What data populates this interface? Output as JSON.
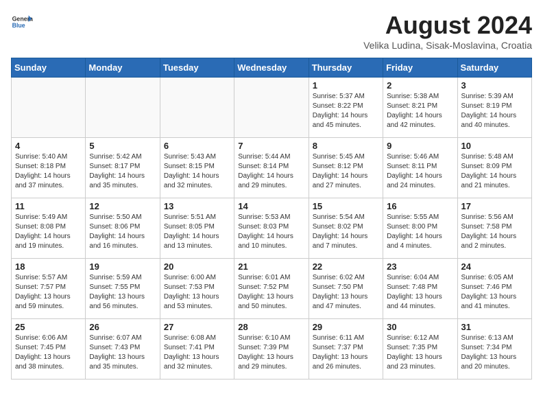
{
  "header": {
    "logo": {
      "general": "General",
      "blue": "Blue"
    },
    "title": "August 2024",
    "location": "Velika Ludina, Sisak-Moslavina, Croatia"
  },
  "weekdays": [
    "Sunday",
    "Monday",
    "Tuesday",
    "Wednesday",
    "Thursday",
    "Friday",
    "Saturday"
  ],
  "weeks": [
    [
      {
        "day": "",
        "info": ""
      },
      {
        "day": "",
        "info": ""
      },
      {
        "day": "",
        "info": ""
      },
      {
        "day": "",
        "info": ""
      },
      {
        "day": "1",
        "info": "Sunrise: 5:37 AM\nSunset: 8:22 PM\nDaylight: 14 hours\nand 45 minutes."
      },
      {
        "day": "2",
        "info": "Sunrise: 5:38 AM\nSunset: 8:21 PM\nDaylight: 14 hours\nand 42 minutes."
      },
      {
        "day": "3",
        "info": "Sunrise: 5:39 AM\nSunset: 8:19 PM\nDaylight: 14 hours\nand 40 minutes."
      }
    ],
    [
      {
        "day": "4",
        "info": "Sunrise: 5:40 AM\nSunset: 8:18 PM\nDaylight: 14 hours\nand 37 minutes."
      },
      {
        "day": "5",
        "info": "Sunrise: 5:42 AM\nSunset: 8:17 PM\nDaylight: 14 hours\nand 35 minutes."
      },
      {
        "day": "6",
        "info": "Sunrise: 5:43 AM\nSunset: 8:15 PM\nDaylight: 14 hours\nand 32 minutes."
      },
      {
        "day": "7",
        "info": "Sunrise: 5:44 AM\nSunset: 8:14 PM\nDaylight: 14 hours\nand 29 minutes."
      },
      {
        "day": "8",
        "info": "Sunrise: 5:45 AM\nSunset: 8:12 PM\nDaylight: 14 hours\nand 27 minutes."
      },
      {
        "day": "9",
        "info": "Sunrise: 5:46 AM\nSunset: 8:11 PM\nDaylight: 14 hours\nand 24 minutes."
      },
      {
        "day": "10",
        "info": "Sunrise: 5:48 AM\nSunset: 8:09 PM\nDaylight: 14 hours\nand 21 minutes."
      }
    ],
    [
      {
        "day": "11",
        "info": "Sunrise: 5:49 AM\nSunset: 8:08 PM\nDaylight: 14 hours\nand 19 minutes."
      },
      {
        "day": "12",
        "info": "Sunrise: 5:50 AM\nSunset: 8:06 PM\nDaylight: 14 hours\nand 16 minutes."
      },
      {
        "day": "13",
        "info": "Sunrise: 5:51 AM\nSunset: 8:05 PM\nDaylight: 14 hours\nand 13 minutes."
      },
      {
        "day": "14",
        "info": "Sunrise: 5:53 AM\nSunset: 8:03 PM\nDaylight: 14 hours\nand 10 minutes."
      },
      {
        "day": "15",
        "info": "Sunrise: 5:54 AM\nSunset: 8:02 PM\nDaylight: 14 hours\nand 7 minutes."
      },
      {
        "day": "16",
        "info": "Sunrise: 5:55 AM\nSunset: 8:00 PM\nDaylight: 14 hours\nand 4 minutes."
      },
      {
        "day": "17",
        "info": "Sunrise: 5:56 AM\nSunset: 7:58 PM\nDaylight: 14 hours\nand 2 minutes."
      }
    ],
    [
      {
        "day": "18",
        "info": "Sunrise: 5:57 AM\nSunset: 7:57 PM\nDaylight: 13 hours\nand 59 minutes."
      },
      {
        "day": "19",
        "info": "Sunrise: 5:59 AM\nSunset: 7:55 PM\nDaylight: 13 hours\nand 56 minutes."
      },
      {
        "day": "20",
        "info": "Sunrise: 6:00 AM\nSunset: 7:53 PM\nDaylight: 13 hours\nand 53 minutes."
      },
      {
        "day": "21",
        "info": "Sunrise: 6:01 AM\nSunset: 7:52 PM\nDaylight: 13 hours\nand 50 minutes."
      },
      {
        "day": "22",
        "info": "Sunrise: 6:02 AM\nSunset: 7:50 PM\nDaylight: 13 hours\nand 47 minutes."
      },
      {
        "day": "23",
        "info": "Sunrise: 6:04 AM\nSunset: 7:48 PM\nDaylight: 13 hours\nand 44 minutes."
      },
      {
        "day": "24",
        "info": "Sunrise: 6:05 AM\nSunset: 7:46 PM\nDaylight: 13 hours\nand 41 minutes."
      }
    ],
    [
      {
        "day": "25",
        "info": "Sunrise: 6:06 AM\nSunset: 7:45 PM\nDaylight: 13 hours\nand 38 minutes."
      },
      {
        "day": "26",
        "info": "Sunrise: 6:07 AM\nSunset: 7:43 PM\nDaylight: 13 hours\nand 35 minutes."
      },
      {
        "day": "27",
        "info": "Sunrise: 6:08 AM\nSunset: 7:41 PM\nDaylight: 13 hours\nand 32 minutes."
      },
      {
        "day": "28",
        "info": "Sunrise: 6:10 AM\nSunset: 7:39 PM\nDaylight: 13 hours\nand 29 minutes."
      },
      {
        "day": "29",
        "info": "Sunrise: 6:11 AM\nSunset: 7:37 PM\nDaylight: 13 hours\nand 26 minutes."
      },
      {
        "day": "30",
        "info": "Sunrise: 6:12 AM\nSunset: 7:35 PM\nDaylight: 13 hours\nand 23 minutes."
      },
      {
        "day": "31",
        "info": "Sunrise: 6:13 AM\nSunset: 7:34 PM\nDaylight: 13 hours\nand 20 minutes."
      }
    ]
  ]
}
